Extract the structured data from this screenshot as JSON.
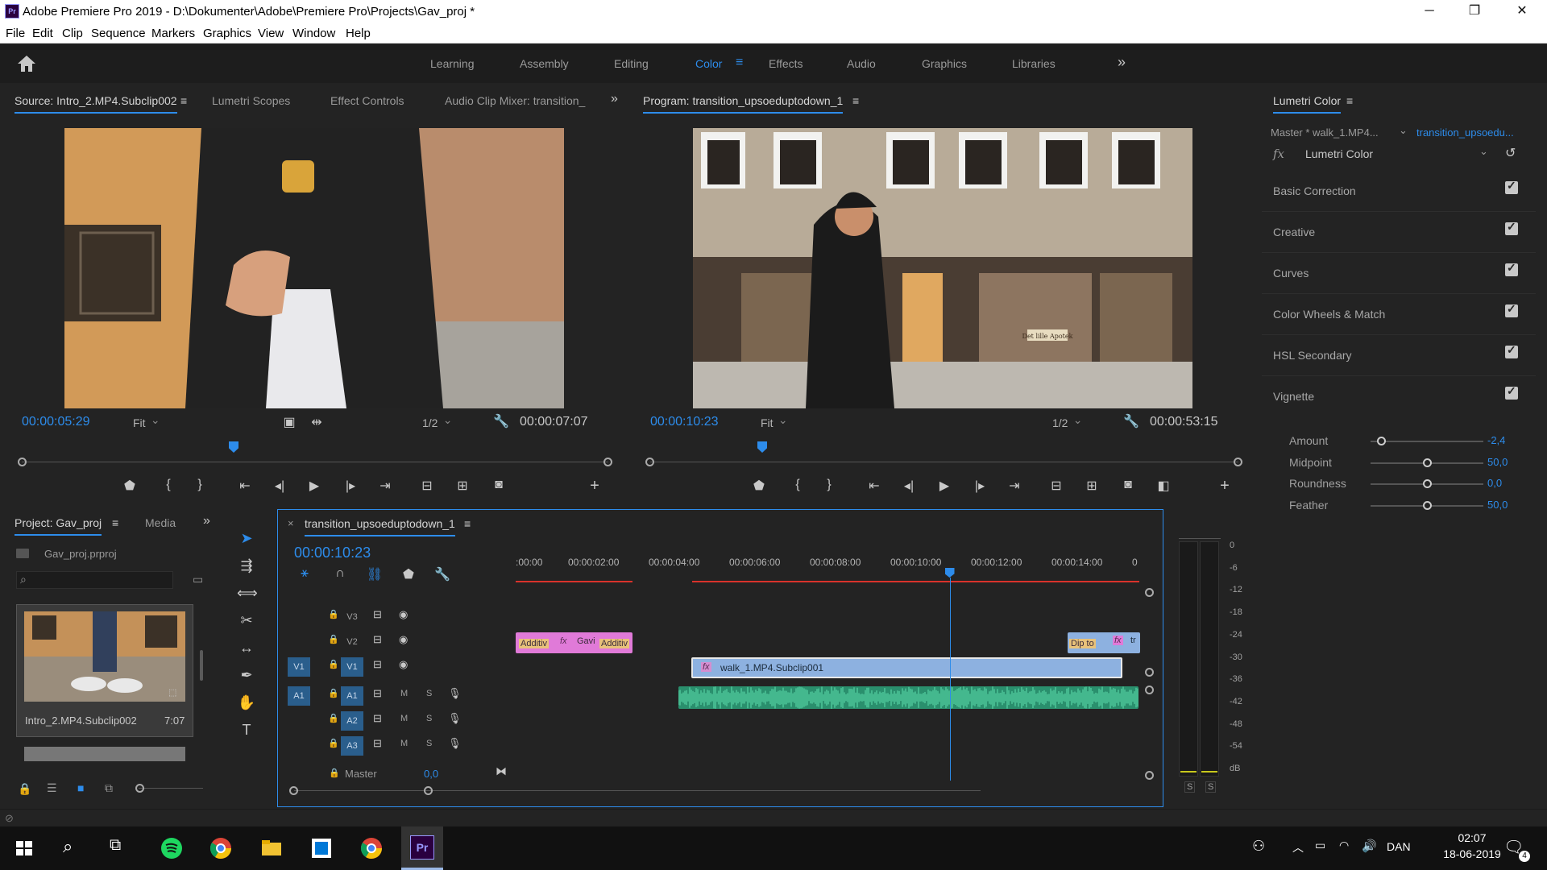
{
  "window": {
    "app_icon_label": "Pr",
    "title": "Adobe Premiere Pro 2019 - D:\\Dokumenter\\Adobe\\Premiere Pro\\Projects\\Gav_proj *",
    "minimize": "─",
    "maximize": "❐",
    "close": "✕"
  },
  "menu": [
    "File",
    "Edit",
    "Clip",
    "Sequence",
    "Markers",
    "Graphics",
    "View",
    "Window",
    "Help"
  ],
  "workspaces": {
    "items": [
      "Learning",
      "Assembly",
      "Editing",
      "Color",
      "Effects",
      "Audio",
      "Graphics",
      "Libraries"
    ],
    "active": "Color",
    "more": "»"
  },
  "source_panel": {
    "tabs": [
      "Source: Intro_2.MP4.Subclip002",
      "Lumetri Scopes",
      "Effect Controls",
      "Audio Clip Mixer: transition_"
    ],
    "more": "»",
    "timecode_in": "00:00:05:29",
    "zoom": "Fit",
    "resolution": "1/2",
    "duration": "00:00:07:07"
  },
  "program_panel": {
    "title": "Program: transition_upsoeduptodown_1",
    "timecode": "00:00:10:23",
    "zoom": "Fit",
    "resolution": "1/2",
    "duration": "00:00:53:15",
    "sign_text": "Det lille Apotek"
  },
  "lumetri": {
    "title": "Lumetri Color",
    "master_clip": "Master * walk_1.MP4...",
    "sequence_clip": "transition_upsoedu...",
    "fx_label": "fx",
    "effect": "Lumetri Color",
    "sections": [
      "Basic Correction",
      "Creative",
      "Curves",
      "Color Wheels & Match",
      "HSL Secondary",
      "Vignette"
    ],
    "vignette": [
      {
        "label": "Amount",
        "value": "-2,4",
        "fraction": 0.09
      },
      {
        "label": "Midpoint",
        "value": "50,0",
        "fraction": 0.5
      },
      {
        "label": "Roundness",
        "value": "0,0",
        "fraction": 0.5
      },
      {
        "label": "Feather",
        "value": "50,0",
        "fraction": 0.5
      }
    ]
  },
  "project": {
    "tabs": [
      "Project: Gav_proj",
      "Media"
    ],
    "more": "»",
    "file": "Gav_proj.prproj",
    "search_placeholder": "",
    "thumb_name": "Intro_2.MP4.Subclip002",
    "thumb_duration": "7:07"
  },
  "timeline": {
    "name": "transition_upsoeduptodown_1",
    "close": "×",
    "timecode": "00:00:10:23",
    "ruler": [
      ":00:00",
      "00:00:02:00",
      "00:00:04:00",
      "00:00:06:00",
      "00:00:08:00",
      "00:00:10:00",
      "00:00:12:00",
      "00:00:14:00",
      "0"
    ],
    "playhead_seconds": 10.77,
    "video_tracks": [
      "V3",
      "V2",
      "V1"
    ],
    "audio_tracks": [
      "A1",
      "A2",
      "A3"
    ],
    "source_patch_v": "V1",
    "source_patch_a": "A1",
    "master_label": "Master",
    "master_value": "0,0",
    "mute": "M",
    "solo": "S",
    "clips": {
      "v2_a_label1": "Additiv",
      "v2_a_label2": "Gavi",
      "v2_a_label3": "Additiv",
      "v2_b_label1": "Dip to",
      "v2_b_label2": "tr",
      "v1_label": "walk_1.MP4.Subclip001",
      "fx": "fx"
    }
  },
  "audio_meter": {
    "scale": [
      "0",
      "-6",
      "-12",
      "-18",
      "-24",
      "-30",
      "-36",
      "-42",
      "-48",
      "-54",
      "dB"
    ],
    "solo": [
      "S",
      "S"
    ]
  },
  "taskbar": {
    "language": "DAN",
    "time": "02:07",
    "date": "18-06-2019",
    "notification_count": "4",
    "premiere_label": "Pr"
  },
  "colors": {
    "accent": "#2d8ceb",
    "panel": "#232323",
    "clip_pink": "#e07ad8",
    "clip_blue": "#8db1e0",
    "audio_green": "#3bb88e",
    "in_out_red": "#d9322b"
  }
}
